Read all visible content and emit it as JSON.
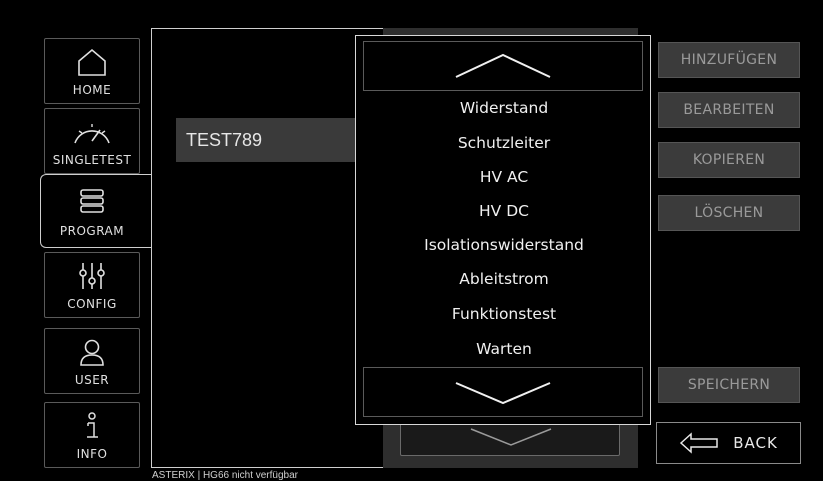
{
  "nav": {
    "items": [
      {
        "label": "HOME",
        "icon": "home-icon"
      },
      {
        "label": "SINGLETEST",
        "icon": "gauge-icon"
      },
      {
        "label": "PROGRAM",
        "icon": "stack-icon",
        "active": true
      },
      {
        "label": "CONFIG",
        "icon": "sliders-icon"
      },
      {
        "label": "USER",
        "icon": "user-icon"
      },
      {
        "label": "INFO",
        "icon": "info-icon"
      }
    ]
  },
  "program": {
    "selected_name": "TEST789"
  },
  "dropdown": {
    "items": [
      "Widerstand",
      "Schutzleiter",
      "HV AC",
      "HV DC",
      "Isolationswiderstand",
      "Ableitstrom",
      "Funktionstest",
      "Warten"
    ]
  },
  "actions": {
    "add": "HINZUFÜGEN",
    "edit": "BEARBEITEN",
    "copy": "KOPIEREN",
    "delete": "LÖSCHEN",
    "save": "SPEICHERN",
    "back": "BACK"
  },
  "status": {
    "text": "ASTERIX | HG66 nicht verfügbar"
  }
}
